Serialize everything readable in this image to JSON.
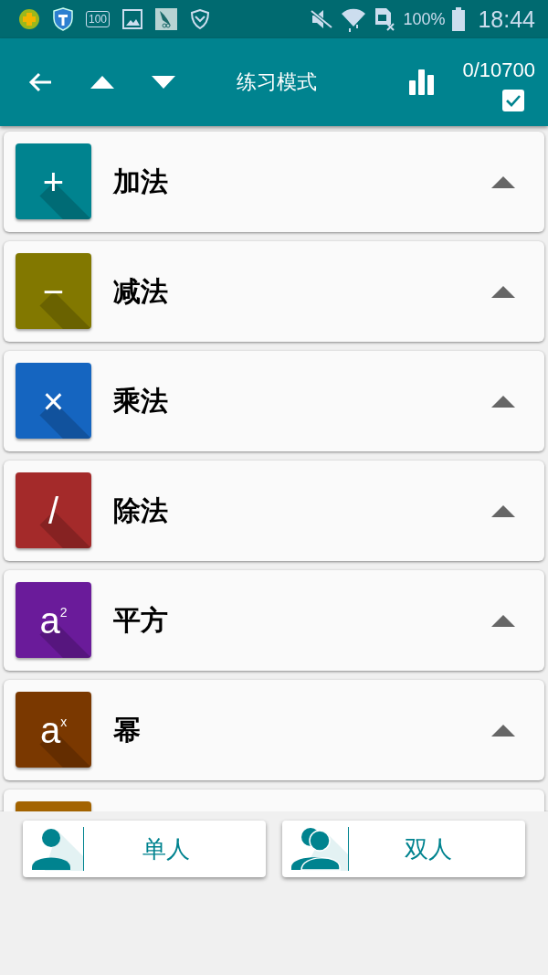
{
  "status_bar": {
    "battery_saver": "100",
    "battery": "100%",
    "time": "18:44"
  },
  "toolbar": {
    "title": "练习模式",
    "counter": "0/10700",
    "select_all": {
      "checked": true
    }
  },
  "categories": [
    {
      "symbol": "+",
      "label": "加法",
      "color": "#00838f"
    },
    {
      "symbol": "−",
      "label": "减法",
      "color": "#827800"
    },
    {
      "symbol": "×",
      "label": "乘法",
      "color": "#1565c0"
    },
    {
      "symbol": "/",
      "label": "除法",
      "color": "#a42a2a"
    },
    {
      "symbol": "a$^{2}$",
      "label": "平方",
      "color": "#6a1b9a"
    },
    {
      "symbol": "a$^{x}$",
      "label": "幂",
      "color": "#7a3800"
    },
    {
      "color": "#a36300"
    }
  ],
  "modes": [
    {
      "label": "单人",
      "kind": "single"
    },
    {
      "label": "双人",
      "kind": "double"
    }
  ]
}
